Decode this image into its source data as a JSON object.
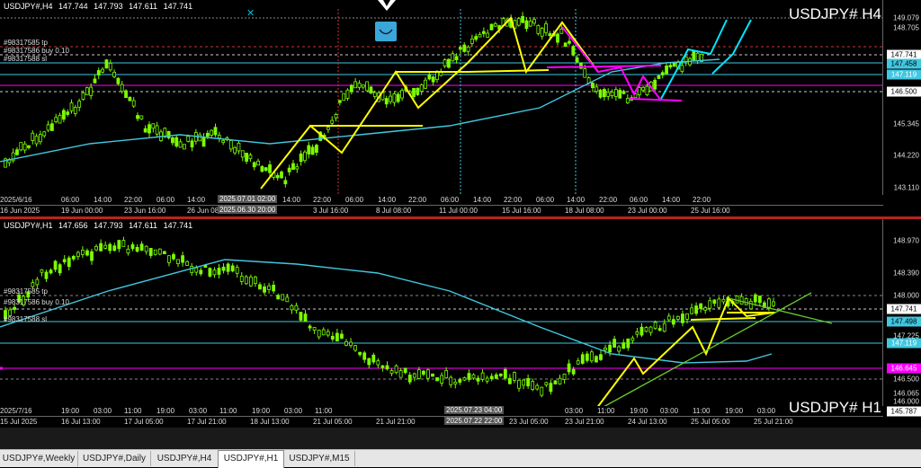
{
  "h4": {
    "header": {
      "symbol": "USDJPY#,H4",
      "o": "147.744",
      "h": "147.793",
      "l": "147.611",
      "c": "147.741"
    },
    "title": "USDJPY# H4",
    "orders": [
      "#98317585 tp",
      "#98317586 buy 0.10",
      "#98317588 sl"
    ],
    "price_labels": [
      "149.079",
      "148.705",
      "147.741",
      "147.458",
      "147.119",
      "146.500",
      "145.345",
      "144.220",
      "143.110"
    ],
    "time_labels": [
      "2025/6/16",
      "06:00",
      "14:00",
      "22:00",
      "06:00",
      "14:00",
      "2025.07.01 02:00",
      "14:00",
      "22:00",
      "06:00",
      "14:00",
      "22:00",
      "06:00",
      "14:00",
      "22:00",
      "06:00",
      "14:00",
      "22:00",
      "06:00",
      "14:00",
      "22:00"
    ],
    "date_labels": [
      "16 Jun 2025",
      "19 Jun 00:00",
      "23 Jun 16:00",
      "26 Jun 08:00",
      "2025.06.30 20:00",
      "3 Jul 16:00",
      "8 Jul 08:00",
      "11 Jul 00:00",
      "15 Jul 16:00",
      "18 Jul 08:00",
      "23 Jul 00:00",
      "25 Jul 16:00"
    ]
  },
  "h1": {
    "header": {
      "symbol": "USDJPY#,H1",
      "o": "147.656",
      "h": "147.793",
      "l": "147.611",
      "c": "147.741"
    },
    "title": "USDJPY# H1",
    "orders": [
      "#98317585 tp",
      "#98317586 buy 0.10",
      "#98317588 sl"
    ],
    "price_labels": [
      "148.970",
      "148.390",
      "148.000",
      "147.741",
      "147.498",
      "147.225",
      "147.119",
      "146.645",
      "146.500",
      "146.065",
      "146.000",
      "145.787"
    ],
    "time_labels": [
      "2025/7/16",
      "19:00",
      "03:00",
      "11:00",
      "19:00",
      "03:00",
      "11:00",
      "19:00",
      "03:00",
      "11:00",
      "2025.07.23 04:00",
      "03:00",
      "11:00",
      "19:00",
      "03:00",
      "11:00",
      "19:00",
      "03:00"
    ],
    "date_labels": [
      "15 Jul 2025",
      "16 Jul 13:00",
      "17 Jul 05:00",
      "17 Jul 21:00",
      "18 Jul 13:00",
      "21 Jul 05:00",
      "21 Jul 21:00",
      "2025.07.22 22:00",
      "23 Jul 05:00",
      "23 Jul 21:00",
      "24 Jul 13:00",
      "25 Jul 05:00",
      "25 Jul 21:00"
    ]
  },
  "tabs": [
    "USDJPY#,Weekly",
    "USDJPY#,Daily",
    "USDJPY#,H4",
    "USDJPY#,H1",
    "USDJPY#,M15"
  ],
  "active_tab": "USDJPY#,H1",
  "colors": {
    "candle": "#7CFC00",
    "ma": "#40c8e0",
    "handdrawn_yellow": "#ffff00",
    "handdrawn_magenta": "#ff00ff",
    "handdrawn_cyan": "#00e5ff",
    "trend_green": "#6acd2a"
  }
}
